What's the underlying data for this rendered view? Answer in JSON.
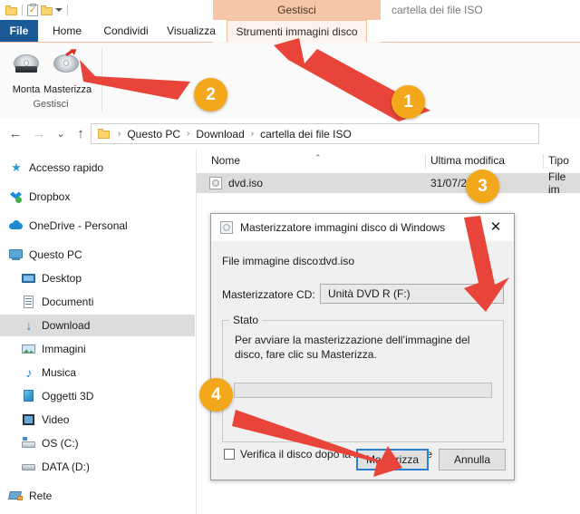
{
  "window": {
    "quick_access": [
      "folder-icon",
      "properties-icon",
      "new-folder-icon",
      "customize-caret-icon"
    ],
    "context_tab_group": "Gestisci",
    "title": "cartella dei file ISO"
  },
  "ribbon": {
    "tabs": [
      {
        "label": "File",
        "id": "file"
      },
      {
        "label": "Home",
        "id": "home"
      },
      {
        "label": "Condividi",
        "id": "share"
      },
      {
        "label": "Visualizza",
        "id": "view"
      },
      {
        "label": "Strumenti immagini disco",
        "id": "disc-image-tools"
      }
    ],
    "group_title": "Gestisci",
    "buttons": [
      {
        "label": "Monta",
        "icon": "mount-disc-icon"
      },
      {
        "label": "Masterizza",
        "icon": "burn-disc-icon"
      }
    ]
  },
  "address_bar": {
    "back": "←",
    "forward": "→",
    "recent": "⌄",
    "up": "↑",
    "crumbs": [
      "Questo PC",
      "Download",
      "cartella dei file ISO"
    ],
    "separator": "›"
  },
  "nav_pane": {
    "items": [
      {
        "label": "Accesso rapido",
        "icon": "star-icon",
        "indent": 0,
        "selected": false
      },
      {
        "label": "Dropbox",
        "icon": "dropbox-icon",
        "indent": 0,
        "selected": false
      },
      {
        "label": "OneDrive - Personal",
        "icon": "cloud-icon",
        "indent": 0,
        "selected": false
      },
      {
        "label": "Questo PC",
        "icon": "this-pc-icon",
        "indent": 0,
        "selected": false
      },
      {
        "label": "Desktop",
        "icon": "desktop-icon",
        "indent": 1,
        "selected": false
      },
      {
        "label": "Documenti",
        "icon": "documents-icon",
        "indent": 1,
        "selected": false
      },
      {
        "label": "Download",
        "icon": "downloads-icon",
        "indent": 1,
        "selected": true
      },
      {
        "label": "Immagini",
        "icon": "pictures-icon",
        "indent": 1,
        "selected": false
      },
      {
        "label": "Musica",
        "icon": "music-icon",
        "indent": 1,
        "selected": false
      },
      {
        "label": "Oggetti 3D",
        "icon": "3d-objects-icon",
        "indent": 1,
        "selected": false
      },
      {
        "label": "Video",
        "icon": "video-icon",
        "indent": 1,
        "selected": false
      },
      {
        "label": "OS (C:)",
        "icon": "os-drive-icon",
        "indent": 1,
        "selected": false
      },
      {
        "label": "DATA (D:)",
        "icon": "drive-icon",
        "indent": 1,
        "selected": false
      },
      {
        "label": "Rete",
        "icon": "network-icon",
        "indent": 0,
        "selected": false
      }
    ]
  },
  "file_list": {
    "columns": [
      "Nome",
      "Ultima modifica",
      "Tipo"
    ],
    "sort_indicator": "⌃",
    "rows": [
      {
        "name": "dvd.iso",
        "modified": "31/07/20",
        "type": "File im",
        "icon": "disc-image-file-icon",
        "selected": true
      }
    ]
  },
  "dialog": {
    "title": "Masterizzatore immagini disco di Windows",
    "icon": "disc-image-icon",
    "close": "✕",
    "image_file_label": "File immagine disco:",
    "image_file_value": "dvd.iso",
    "burner_label": "Masterizzatore CD:",
    "burner_value": "Unità DVD R (F:)",
    "burner_caret": "⌄",
    "status_legend": "Stato",
    "status_text": "Per avviare la masterizzazione dell’immagine del disco, fare clic su Masterizza.",
    "verify_label": "Verifica il disco dopo la masterizzazione",
    "verify_checked": false,
    "burn_button": "Masterizza",
    "cancel_button": "Annulla"
  },
  "annotations": {
    "accent_color": "#f2a81a",
    "arrow_color": "#e8443a",
    "badges": [
      {
        "number": "1",
        "target": "disc-image-tools-tab"
      },
      {
        "number": "2",
        "target": "burn-ribbon-button"
      },
      {
        "number": "3",
        "target": "burner-combobox"
      },
      {
        "number": "4",
        "target": "burn-dialog-button"
      }
    ]
  }
}
